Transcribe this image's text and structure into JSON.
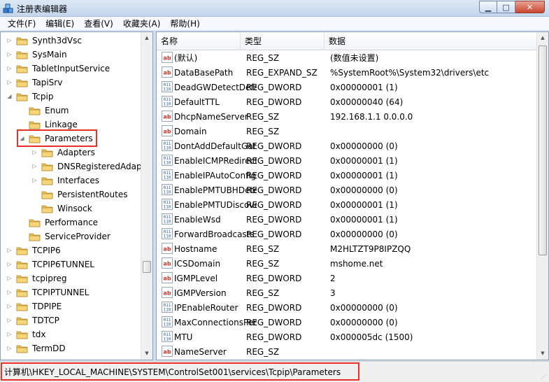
{
  "window": {
    "title": "注册表编辑器",
    "minimize_glyph": "▁",
    "maximize_glyph": "□",
    "close_glyph": "✕"
  },
  "menu": [
    {
      "label": "文件(F)"
    },
    {
      "label": "编辑(E)"
    },
    {
      "label": "查看(V)"
    },
    {
      "label": "收藏夹(A)"
    },
    {
      "label": "帮助(H)"
    }
  ],
  "tree": {
    "items": [
      {
        "label": "Synth3dVsc",
        "level": 0,
        "expander": "▷"
      },
      {
        "label": "SysMain",
        "level": 0,
        "expander": "▷"
      },
      {
        "label": "TabletInputService",
        "level": 0,
        "expander": "▷"
      },
      {
        "label": "TapiSrv",
        "level": 0,
        "expander": "▷"
      },
      {
        "label": "Tcpip",
        "level": 0,
        "expander": "◢"
      },
      {
        "label": "Enum",
        "level": 1,
        "expander": ""
      },
      {
        "label": "Linkage",
        "level": 1,
        "expander": ""
      },
      {
        "label": "Parameters",
        "level": 1,
        "expander": "◢",
        "selected": true
      },
      {
        "label": "Adapters",
        "level": 2,
        "expander": "▷"
      },
      {
        "label": "DNSRegisteredAdapters",
        "level": 2,
        "expander": "▷"
      },
      {
        "label": "Interfaces",
        "level": 2,
        "expander": "▷"
      },
      {
        "label": "PersistentRoutes",
        "level": 2,
        "expander": ""
      },
      {
        "label": "Winsock",
        "level": 2,
        "expander": ""
      },
      {
        "label": "Performance",
        "level": 1,
        "expander": ""
      },
      {
        "label": "ServiceProvider",
        "level": 1,
        "expander": ""
      },
      {
        "label": "TCPIP6",
        "level": 0,
        "expander": "▷"
      },
      {
        "label": "TCPIP6TUNNEL",
        "level": 0,
        "expander": "▷"
      },
      {
        "label": "tcpipreg",
        "level": 0,
        "expander": "▷"
      },
      {
        "label": "TCPIPTUNNEL",
        "level": 0,
        "expander": "▷"
      },
      {
        "label": "TDPIPE",
        "level": 0,
        "expander": "▷"
      },
      {
        "label": "TDTCP",
        "level": 0,
        "expander": "▷"
      },
      {
        "label": "tdx",
        "level": 0,
        "expander": "▷"
      },
      {
        "label": "TermDD",
        "level": 0,
        "expander": "▷"
      }
    ]
  },
  "values_pane": {
    "columns": {
      "name": "名称",
      "type": "类型",
      "data": "数据"
    },
    "rows": [
      {
        "name": "(默认)",
        "type": "REG_SZ",
        "data": "(数值未设置)",
        "icon": "string"
      },
      {
        "name": "DataBasePath",
        "type": "REG_EXPAND_SZ",
        "data": "%SystemRoot%\\System32\\drivers\\etc",
        "icon": "string"
      },
      {
        "name": "DeadGWDetectDefault",
        "type": "REG_DWORD",
        "data": "0x00000001 (1)",
        "icon": "binary"
      },
      {
        "name": "DefaultTTL",
        "type": "REG_DWORD",
        "data": "0x00000040 (64)",
        "icon": "binary"
      },
      {
        "name": "DhcpNameServer",
        "type": "REG_SZ",
        "data": "192.168.1.1 0.0.0.0",
        "icon": "string"
      },
      {
        "name": "Domain",
        "type": "REG_SZ",
        "data": "",
        "icon": "string"
      },
      {
        "name": "DontAddDefaultGateway",
        "type": "REG_DWORD",
        "data": "0x00000000 (0)",
        "icon": "binary"
      },
      {
        "name": "EnableICMPRedirect",
        "type": "REG_DWORD",
        "data": "0x00000001 (1)",
        "icon": "binary"
      },
      {
        "name": "EnableIPAutoConfig",
        "type": "REG_DWORD",
        "data": "0x00000001 (1)",
        "icon": "binary"
      },
      {
        "name": "EnablePMTUBHDetect",
        "type": "REG_DWORD",
        "data": "0x00000000 (0)",
        "icon": "binary"
      },
      {
        "name": "EnablePMTUDiscovery",
        "type": "REG_DWORD",
        "data": "0x00000001 (1)",
        "icon": "binary"
      },
      {
        "name": "EnableWsd",
        "type": "REG_DWORD",
        "data": "0x00000001 (1)",
        "icon": "binary"
      },
      {
        "name": "ForwardBroadcasts",
        "type": "REG_DWORD",
        "data": "0x00000000 (0)",
        "icon": "binary"
      },
      {
        "name": "Hostname",
        "type": "REG_SZ",
        "data": "M2HLTZT9P8IPZQQ",
        "icon": "string"
      },
      {
        "name": "ICSDomain",
        "type": "REG_SZ",
        "data": "mshome.net",
        "icon": "string"
      },
      {
        "name": "IGMPLevel",
        "type": "REG_DWORD",
        "data": "2",
        "icon": "string"
      },
      {
        "name": "IGMPVersion",
        "type": "REG_SZ",
        "data": "3",
        "icon": "string"
      },
      {
        "name": "IPEnableRouter",
        "type": "REG_DWORD",
        "data": "0x00000000 (0)",
        "icon": "binary"
      },
      {
        "name": "MaxConnectionsPerServer",
        "type": "REG_DWORD",
        "data": "0x00000000 (0)",
        "icon": "binary"
      },
      {
        "name": "MTU",
        "type": "REG_DWORD",
        "data": "0x000005dc (1500)",
        "icon": "binary"
      },
      {
        "name": "NameServer",
        "type": "REG_SZ",
        "data": "",
        "icon": "string"
      }
    ]
  },
  "status": {
    "path": "计算机\\HKEY_LOCAL_MACHINE\\SYSTEM\\ControlSet001\\services\\Tcpip\\Parameters"
  },
  "colors": {
    "highlight": "#e8302a",
    "folder": "#e9c35a",
    "string_icon": "#c0392b",
    "binary_icon": "#2f5ea8"
  }
}
